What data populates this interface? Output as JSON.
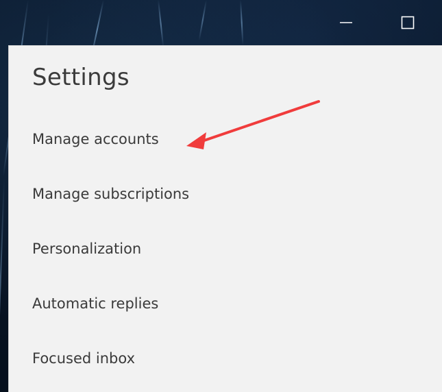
{
  "window": {
    "controls": {
      "minimize_icon": "minimize-icon",
      "maximize_icon": "maximize-icon",
      "close_icon": "close-icon"
    }
  },
  "settings": {
    "title": "Settings",
    "items": [
      {
        "label": "Manage accounts"
      },
      {
        "label": "Manage subscriptions"
      },
      {
        "label": "Personalization"
      },
      {
        "label": "Automatic replies"
      },
      {
        "label": "Focused inbox"
      }
    ]
  },
  "annotation": {
    "arrow_color": "#f03c3c"
  },
  "colors": {
    "panel_background": "#f2f2f2",
    "text": "#3a3a3a"
  }
}
